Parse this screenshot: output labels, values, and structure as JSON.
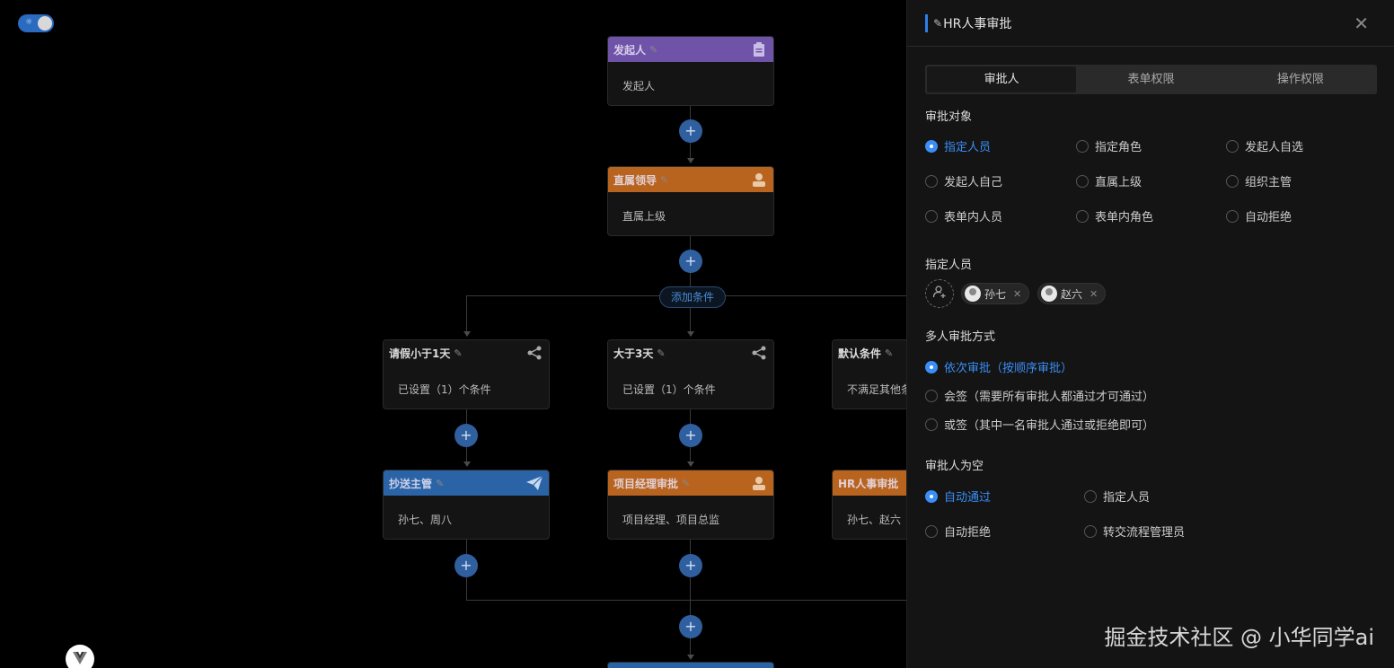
{
  "canvas": {
    "add_condition_label": "添加条件",
    "nodes": {
      "initiator": {
        "title": "发起人",
        "body": "发起人"
      },
      "leader": {
        "title": "直属领导",
        "body": "直属上级"
      },
      "cond1": {
        "title": "请假小于1天",
        "body": "已设置（1）个条件"
      },
      "cond2": {
        "title": "大于3天",
        "body": "已设置（1）个条件"
      },
      "cond3": {
        "title": "默认条件",
        "body": "不满足其他条"
      },
      "cc": {
        "title": "抄送主管",
        "body": "孙七、周八"
      },
      "pm": {
        "title": "项目经理审批",
        "body": "项目经理、项目总监"
      },
      "hr": {
        "title": "HR人事审批",
        "body": "孙七、赵六"
      }
    },
    "plus_symbol": "+",
    "edit_symbol": "✎"
  },
  "drawer": {
    "title": "HR人事审批",
    "tabs": [
      "审批人",
      "表单权限",
      "操作权限"
    ],
    "approval_target": {
      "label": "审批对象",
      "options": [
        "指定人员",
        "指定角色",
        "发起人自选",
        "发起人自己",
        "直属上级",
        "组织主管",
        "表单内人员",
        "表单内角色",
        "自动拒绝"
      ]
    },
    "assigned": {
      "label": "指定人员",
      "users": [
        "孙七",
        "赵六"
      ]
    },
    "multi_mode": {
      "label": "多人审批方式",
      "options": [
        "依次审批（按顺序审批）",
        "会签（需要所有审批人都通过才可通过）",
        "或签（其中一名审批人通过或拒绝即可）"
      ]
    },
    "empty_handling": {
      "label": "审批人为空",
      "options": [
        "自动通过",
        "指定人员",
        "自动拒绝",
        "转交流程管理员"
      ]
    }
  },
  "watermark": "掘金技术社区 @ 小华同学ai",
  "colors": {
    "accent": "#3a8ef6",
    "initiator_header": "#6f53a8",
    "approver_header": "#b8641f",
    "cc_header": "#2a64a6"
  }
}
